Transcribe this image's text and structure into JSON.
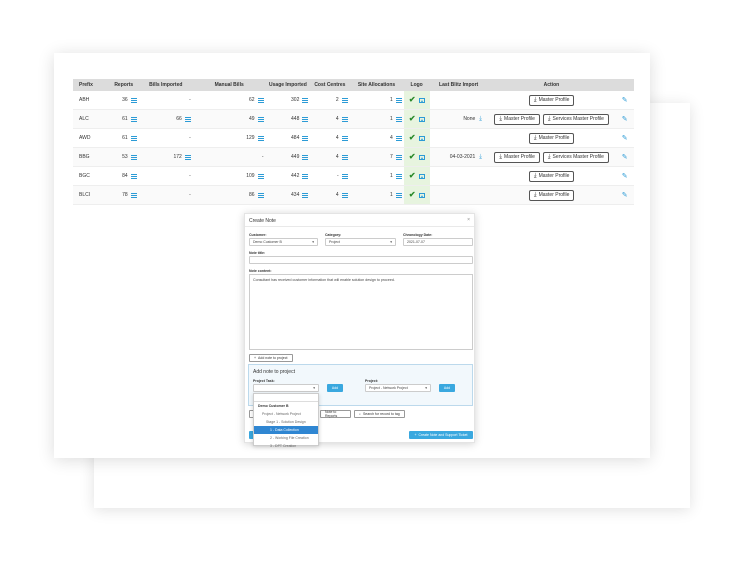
{
  "table": {
    "headers": [
      "Prefix",
      "Reports",
      "Bills Imported",
      "Manual Bills",
      "Usage Imported",
      "Cost Centres",
      "Site Allocations",
      "Logo",
      "Last Blitz Import",
      "Action"
    ],
    "rows": [
      {
        "prefix": "ABH",
        "reports": "36",
        "bills": "-",
        "manual": "62",
        "usage": "302",
        "cost": "2",
        "site": "1",
        "last": "",
        "actions": [
          "Master Profile"
        ]
      },
      {
        "prefix": "ALC",
        "reports": "61",
        "bills": "66",
        "manual": "49",
        "usage": "448",
        "cost": "4",
        "site": "1",
        "last": "None",
        "actions": [
          "Master Profile",
          "Services Master Profile"
        ]
      },
      {
        "prefix": "AWD",
        "reports": "61",
        "bills": "-",
        "manual": "129",
        "usage": "484",
        "cost": "4",
        "site": "4",
        "last": "",
        "actions": [
          "Master Profile"
        ]
      },
      {
        "prefix": "BBG",
        "reports": "53",
        "bills": "172",
        "manual": "-",
        "usage": "449",
        "cost": "4",
        "site": "7",
        "last": "04-03-2021",
        "actions": [
          "Master Profile",
          "Services Master Profile"
        ]
      },
      {
        "prefix": "BGC",
        "reports": "84",
        "bills": "-",
        "manual": "109",
        "usage": "442",
        "cost": "-",
        "site": "1",
        "last": "",
        "actions": [
          "Master Profile"
        ]
      },
      {
        "prefix": "BLCI",
        "reports": "78",
        "bills": "-",
        "manual": "86",
        "usage": "434",
        "cost": "4",
        "site": "1",
        "last": "",
        "actions": [
          "Master Profile"
        ]
      }
    ]
  },
  "modal": {
    "title": "Create Note",
    "close": "×",
    "customer_label": "Customer:",
    "customer_value": "Demo Customer B",
    "category_label": "Category:",
    "category_value": "Project",
    "chronology_label": "Chronology Date:",
    "chronology_value": "2021-07-07",
    "title_label": "Note title:",
    "content_label": "Note content:",
    "content_value": "Consultant has received customer information that will enable solution design to proceed.",
    "add_note_project_btn": "Add note to project",
    "sub_title": "Add note to project",
    "project_task_label": "Project Task:",
    "project_label": "Project:",
    "project_value": "Project - Network Project",
    "add_btn": "Add",
    "add_btn_2": "Add",
    "note_reports_btn": "Note to Reports",
    "search_record_btn": "Search for record to tag",
    "create_btn": "Create Note and Support Ticket"
  },
  "dropdown": {
    "items": [
      {
        "label": "Demo Customer B",
        "cls": "bold"
      },
      {
        "label": "Project - Network Project",
        "cls": "i1"
      },
      {
        "label": "Stage 1 - Solution Design",
        "cls": "i2"
      },
      {
        "label": "1 - Data Collection",
        "cls": "sel"
      },
      {
        "label": "2 - Working File Creation",
        "cls": "i3"
      },
      {
        "label": "3 - DPT Creation",
        "cls": "i3"
      }
    ]
  },
  "colors": {
    "accent": "#3aa8df",
    "check": "#2a8a2a",
    "logo_bg": "#e7f4df"
  }
}
